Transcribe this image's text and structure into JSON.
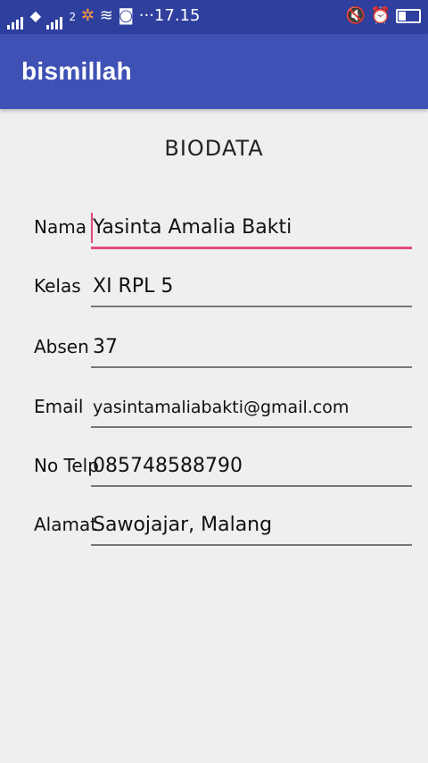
{
  "status_bar": {
    "left_text": "2",
    "time": "···17.15"
  },
  "app_bar": {
    "title": "bismillah"
  },
  "form": {
    "heading": "BIODATA",
    "fields": [
      {
        "label": "Nama",
        "value": "Yasinta Amalia Bakti"
      },
      {
        "label": "Kelas",
        "value": "XI RPL 5"
      },
      {
        "label": "Absen",
        "value": "37"
      },
      {
        "label": "Email",
        "value": "yasintamaliabakti@gmail.com"
      },
      {
        "label": "No Telp",
        "value": "085748588790"
      },
      {
        "label": "Alamat",
        "value": "Sawojajar, Malang"
      }
    ]
  },
  "colors": {
    "status_bar": "#2f3f9e",
    "app_bar": "#3f51b5",
    "accent": "#e04a7a",
    "background": "#efefef"
  }
}
